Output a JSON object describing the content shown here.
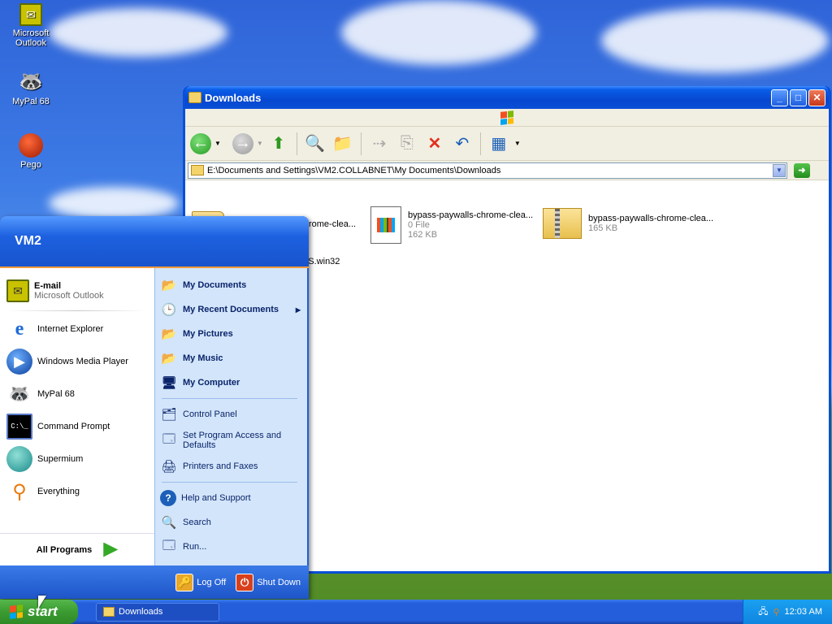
{
  "desktop_icons": [
    {
      "label": "Microsoft Outlook",
      "icon": "outlook-icon"
    },
    {
      "label": "MyPal 68",
      "icon": "mypal-icon"
    },
    {
      "label": "Pego",
      "icon": "pego-icon"
    }
  ],
  "window": {
    "title": "Downloads",
    "address": "E:\\Documents and Settings\\VM2.COLLABNET\\My Documents\\Downloads",
    "files": [
      {
        "name": "bypass-paywalls-chrome-clea...",
        "type": "folder"
      },
      {
        "name": "bypass-paywalls-chrome-clea...",
        "line2": "0 File",
        "line3": "162 KB",
        "type": "file"
      },
      {
        "name": "bypass-paywalls-chrome-clea...",
        "line2": "165 KB",
        "type": "zip"
      },
      {
        "name": "...0S.win32",
        "type": "file"
      }
    ]
  },
  "start_menu": {
    "user": "VM2",
    "pinned": [
      {
        "title": "E-mail",
        "subtitle": "Microsoft Outlook"
      }
    ],
    "recent": [
      {
        "label": "Internet Explorer"
      },
      {
        "label": "Windows Media Player"
      },
      {
        "label": "MyPal 68"
      },
      {
        "label": "Command Prompt"
      },
      {
        "label": "Supermium"
      },
      {
        "label": "Everything"
      }
    ],
    "all_programs": "All Programs",
    "right_top": [
      {
        "label": "My Documents"
      },
      {
        "label": "My Recent Documents"
      },
      {
        "label": "My Pictures"
      },
      {
        "label": "My Music"
      },
      {
        "label": "My Computer"
      }
    ],
    "right_mid": [
      {
        "label": "Control Panel"
      },
      {
        "label": "Set Program Access and Defaults"
      },
      {
        "label": "Printers and Faxes"
      }
    ],
    "right_bottom": [
      {
        "label": "Help and Support"
      },
      {
        "label": "Search"
      },
      {
        "label": "Run..."
      }
    ],
    "log_off": "Log Off",
    "shut_down": "Shut Down"
  },
  "taskbar": {
    "start_label": "start",
    "task_label": "Downloads",
    "clock": "12:03 AM"
  },
  "colors": {
    "taskbar_blue": "#245edb",
    "start_green": "#3b9b31",
    "title_blue": "#0a4fd6"
  }
}
